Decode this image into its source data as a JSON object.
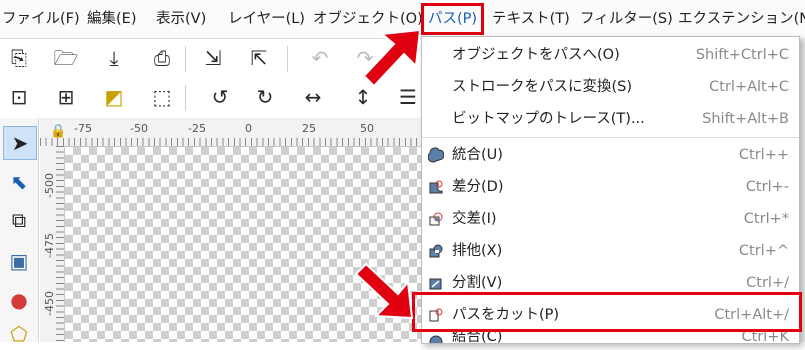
{
  "menubar": {
    "items": [
      {
        "label": "ファイル(F)"
      },
      {
        "label": "編集(E)"
      },
      {
        "label": "表示(V)"
      },
      {
        "label": "レイヤー(L)"
      },
      {
        "label": "オブジェクト(O)"
      },
      {
        "label": "パス(P)"
      },
      {
        "label": "テキスト(T)"
      },
      {
        "label": "フィルター(S)"
      },
      {
        "label": "エクステンション(N)"
      }
    ]
  },
  "ruler": {
    "h_ticks": [
      "-75",
      "-50",
      "-25",
      "0",
      "25",
      "50"
    ],
    "v_ticks": [
      "-500",
      "-475",
      "-450"
    ]
  },
  "path_menu": {
    "items": [
      {
        "label": "オブジェクトをパスへ(O)",
        "shortcut": "Shift+Ctrl+C"
      },
      {
        "label": "ストロークをパスに変換(S)",
        "shortcut": "Ctrl+Alt+C"
      },
      {
        "label": "ビットマップのトレース(T)...",
        "shortcut": "Shift+Alt+B"
      },
      {
        "label": "統合(U)",
        "shortcut": "Ctrl++",
        "icon": "union-icon"
      },
      {
        "label": "差分(D)",
        "shortcut": "Ctrl+-",
        "icon": "difference-icon"
      },
      {
        "label": "交差(I)",
        "shortcut": "Ctrl+*",
        "icon": "intersection-icon"
      },
      {
        "label": "排他(X)",
        "shortcut": "Ctrl+^",
        "icon": "exclusion-icon"
      },
      {
        "label": "分割(V)",
        "shortcut": "Ctrl+/",
        "icon": "division-icon"
      },
      {
        "label": "パスをカット(P)",
        "shortcut": "Ctrl+Alt+/",
        "icon": "cut-path-icon"
      },
      {
        "label": "結合(C)",
        "shortcut": "Ctrl+K",
        "icon": "combine-icon"
      }
    ]
  },
  "colors": {
    "highlight": "#e0000f",
    "active_menu": "#1a5fb4"
  }
}
